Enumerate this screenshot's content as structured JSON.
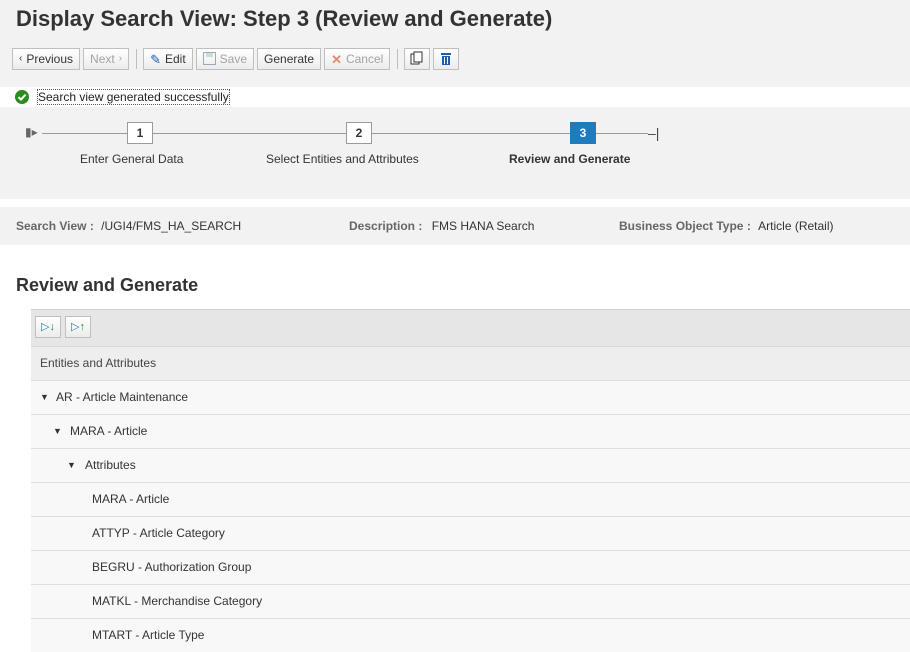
{
  "page": {
    "title": "Display Search View: Step 3  (Review and Generate)"
  },
  "toolbar": {
    "previous_label": "Previous",
    "next_label": "Next",
    "edit_label": "Edit",
    "save_label": "Save",
    "generate_label": "Generate",
    "cancel_label": "Cancel"
  },
  "message": {
    "text": "Search view generated successfully"
  },
  "roadmap": {
    "steps": [
      {
        "number": "1",
        "label": "Enter General Data"
      },
      {
        "number": "2",
        "label": "Select Entities and Attributes"
      },
      {
        "number": "3",
        "label": "Review and Generate"
      }
    ]
  },
  "info": {
    "search_view_label": "Search View :",
    "search_view_value": "/UGI4/FMS_HA_SEARCH",
    "description_label": "Description :",
    "description_value": "FMS HANA Search",
    "bo_type_label": "Business Object Type :",
    "bo_type_value": "Article (Retail)"
  },
  "review": {
    "section_title": "Review and Generate",
    "column_header": "Entities and Attributes",
    "rows": [
      {
        "label": "AR - Article Maintenance"
      },
      {
        "label": "MARA - Article"
      },
      {
        "label": "Attributes"
      },
      {
        "label": "MARA - Article"
      },
      {
        "label": "ATTYP - Article Category"
      },
      {
        "label": "BEGRU - Authorization Group"
      },
      {
        "label": "MATKL - Merchandise Category"
      },
      {
        "label": "MTART - Article Type"
      }
    ]
  },
  "colors": {
    "accent": "#1f7abf",
    "success": "#2b8c1f",
    "panel": "#f2f2f2"
  }
}
